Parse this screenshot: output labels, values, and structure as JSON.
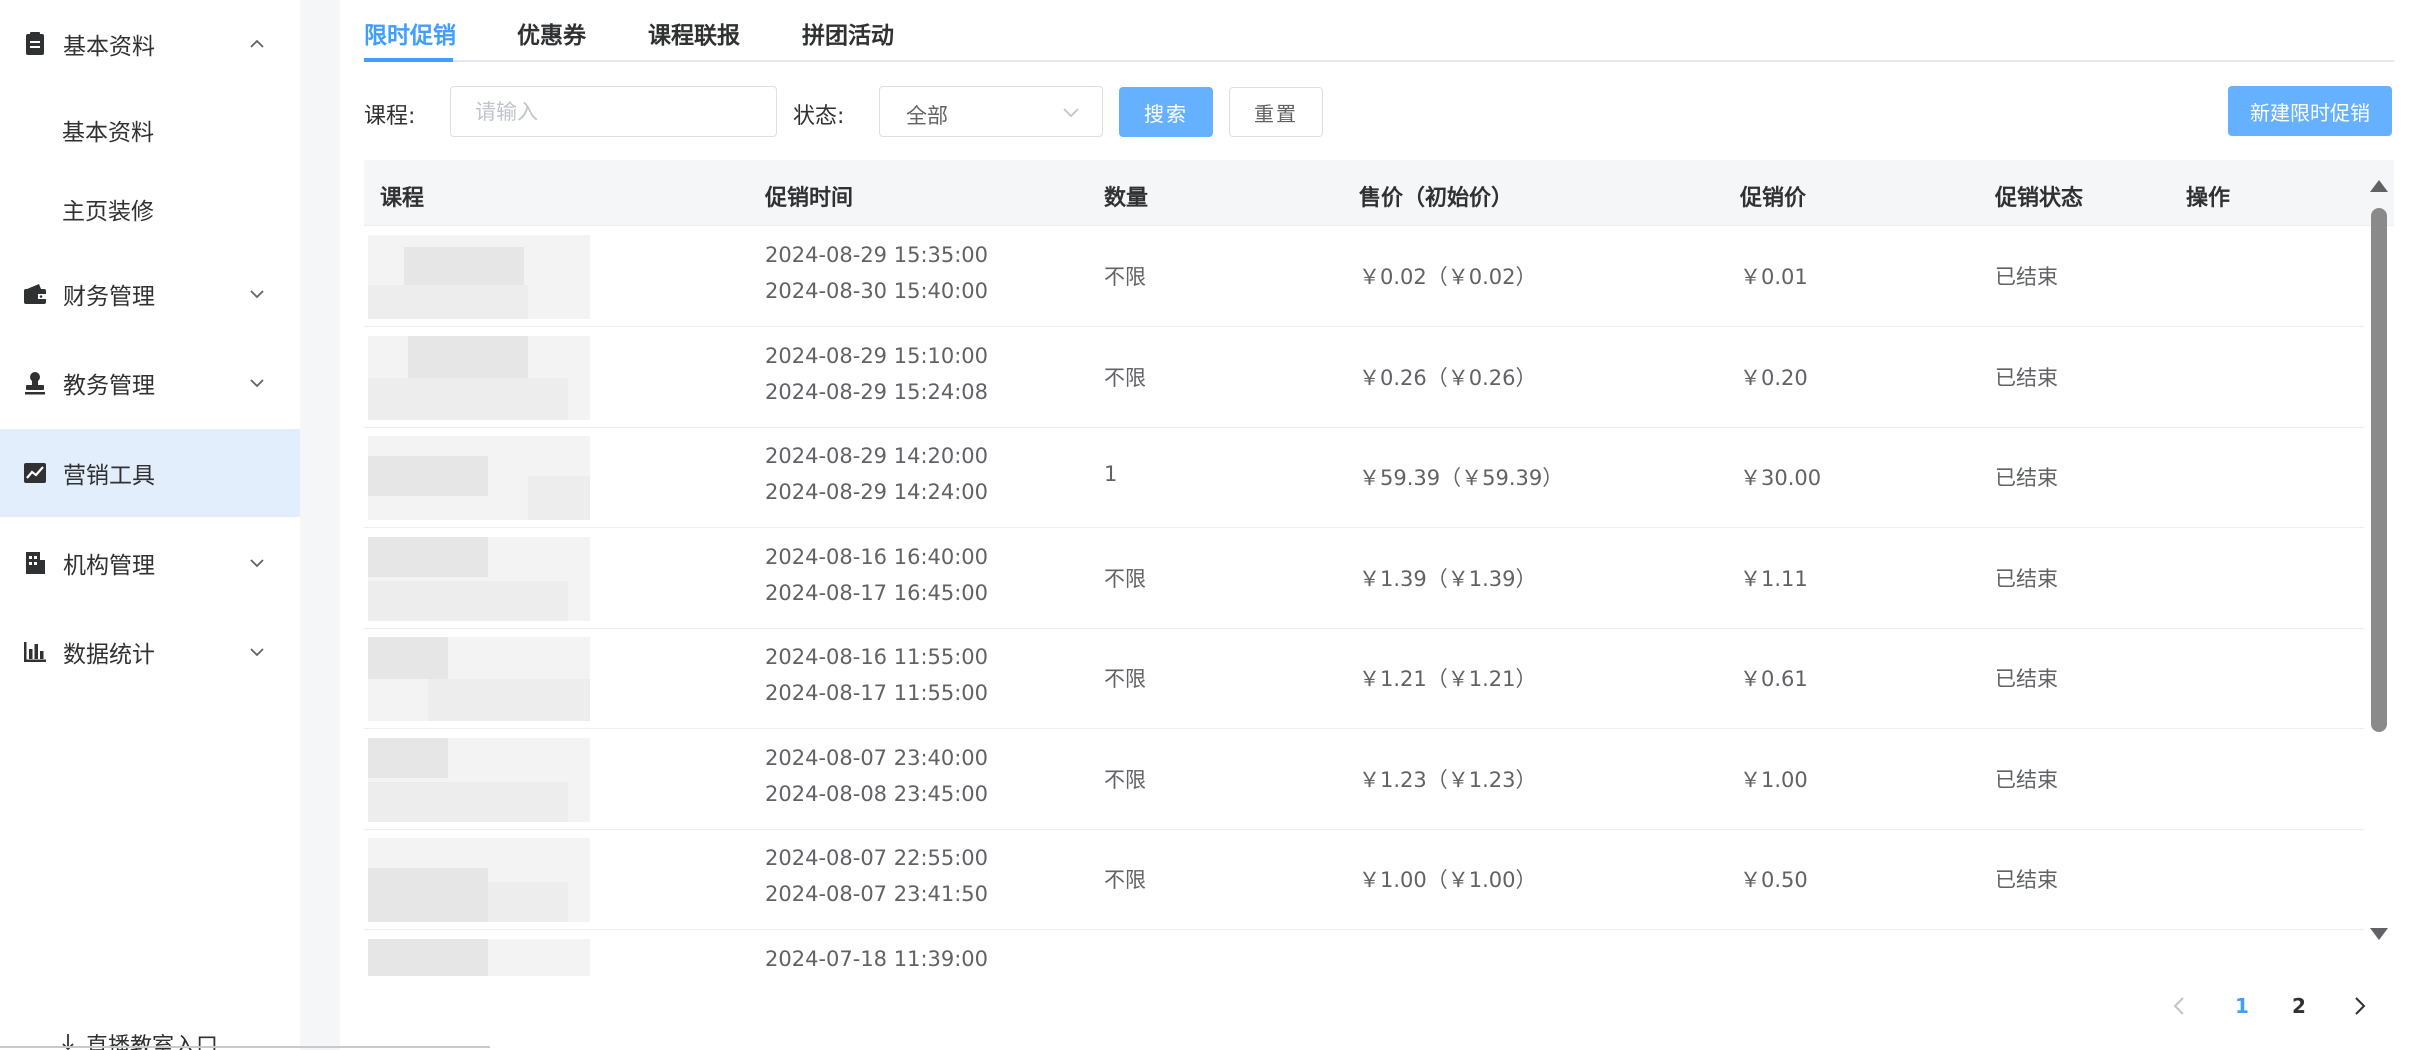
{
  "sidebar": {
    "items": [
      {
        "label": "基本资料",
        "icon": "document-icon",
        "expanded": true
      },
      {
        "label": "财务管理",
        "icon": "wallet-icon",
        "expanded": false
      },
      {
        "label": "教务管理",
        "icon": "user-stamp-icon",
        "expanded": false
      },
      {
        "label": "营销工具",
        "icon": "trend-chart-icon",
        "active": true
      },
      {
        "label": "机构管理",
        "icon": "building-icon",
        "expanded": false
      },
      {
        "label": "数据统计",
        "icon": "bar-chart-icon",
        "expanded": false
      }
    ],
    "sub_items": [
      {
        "label": "基本资料"
      },
      {
        "label": "主页装修"
      }
    ],
    "live_entry": "直播教室入口"
  },
  "tabs": [
    {
      "label": "限时促销",
      "active": true
    },
    {
      "label": "优惠券"
    },
    {
      "label": "课程联报"
    },
    {
      "label": "拼团活动"
    }
  ],
  "filters": {
    "course_label": "课程:",
    "course_placeholder": "请输入",
    "status_label": "状态:",
    "status_value": "全部",
    "search_button": "搜索",
    "reset_button": "重置",
    "new_button": "新建限时促销"
  },
  "table": {
    "headers": [
      "课程",
      "促销时间",
      "数量",
      "售价（初始价）",
      "促销价",
      "促销状态",
      "操作"
    ],
    "rows": [
      {
        "start": "2024-08-29 15:35:00",
        "end": "2024-08-30 15:40:00",
        "qty": "不限",
        "price": "￥0.02（￥0.02）",
        "promo": "￥0.01",
        "status": "已结束"
      },
      {
        "start": "2024-08-29 15:10:00",
        "end": "2024-08-29 15:24:08",
        "qty": "不限",
        "price": "￥0.26（￥0.26）",
        "promo": "￥0.20",
        "status": "已结束"
      },
      {
        "start": "2024-08-29 14:20:00",
        "end": "2024-08-29 14:24:00",
        "qty": "1",
        "price": "￥59.39（￥59.39）",
        "promo": "￥30.00",
        "status": "已结束"
      },
      {
        "start": "2024-08-16 16:40:00",
        "end": "2024-08-17 16:45:00",
        "qty": "不限",
        "price": "￥1.39（￥1.39）",
        "promo": "￥1.11",
        "status": "已结束"
      },
      {
        "start": "2024-08-16 11:55:00",
        "end": "2024-08-17 11:55:00",
        "qty": "不限",
        "price": "￥1.21（￥1.21）",
        "promo": "￥0.61",
        "status": "已结束"
      },
      {
        "start": "2024-08-07 23:40:00",
        "end": "2024-08-08 23:45:00",
        "qty": "不限",
        "price": "￥1.23（￥1.23）",
        "promo": "￥1.00",
        "status": "已结束"
      },
      {
        "start": "2024-08-07 22:55:00",
        "end": "2024-08-07 23:41:50",
        "qty": "不限",
        "price": "￥1.00（￥1.00）",
        "promo": "￥0.50",
        "status": "已结束"
      },
      {
        "start": "2024-07-18 11:39:00",
        "end": "",
        "qty": "",
        "price": "",
        "promo": "",
        "status": ""
      }
    ]
  },
  "pagination": {
    "pages": [
      "1",
      "2"
    ],
    "current": "1"
  },
  "colors": {
    "accent": "#409eff",
    "accent_light": "#66b1ff",
    "active_nav_bg": "#e3eefc"
  }
}
